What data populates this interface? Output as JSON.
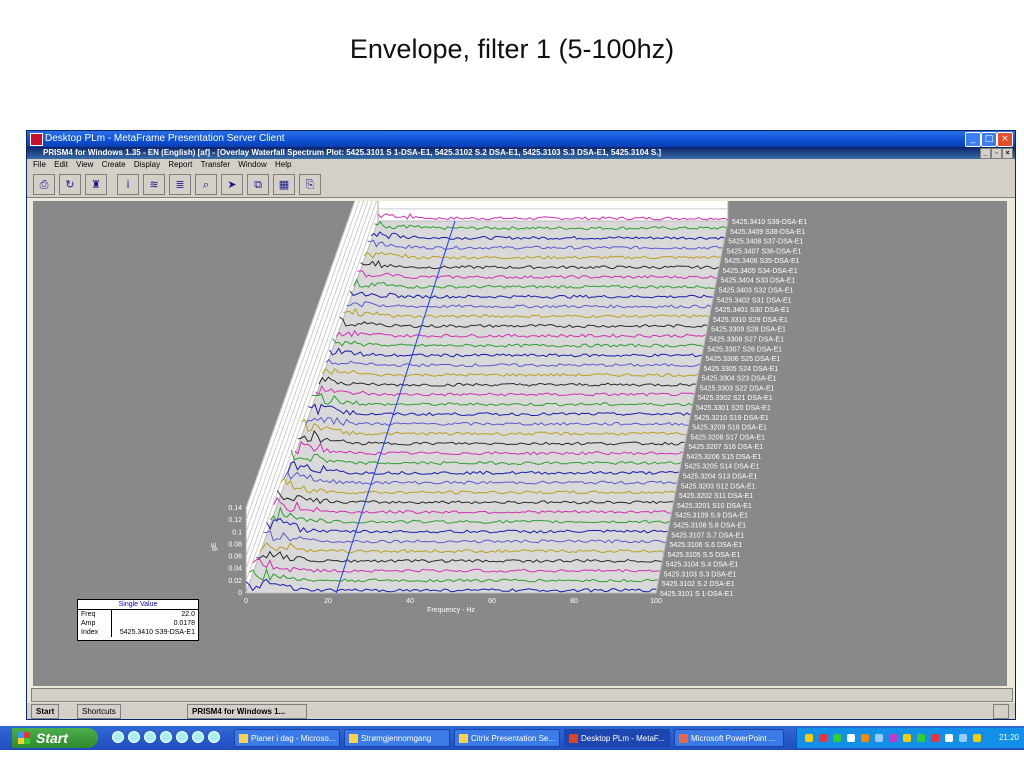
{
  "slide": {
    "title": "Envelope, filter 1 (5-100hz)"
  },
  "outer_window": {
    "title": "Desktop PLm - MetaFrame Presentation Server Client"
  },
  "inner_window": {
    "title": "PRISM4 for Windows 1.35 - EN (English) [af] - [Overlay Waterfall Spectrum Plot: 5425.3101 S 1-DSA-E1, 5425.3102 S.2 DSA-E1, 5425.3103 S.3 DSA-E1, 5425.3104 S.]"
  },
  "menu": [
    "File",
    "Edit",
    "View",
    "Create",
    "Display",
    "Report",
    "Transfer",
    "Window",
    "Help"
  ],
  "toolbar_icons": [
    "printer-icon",
    "refresh-icon",
    "tree-icon",
    "info-icon",
    "waterfall-icon",
    "spectrum-icon",
    "zoom-icon",
    "cursor-icon",
    "overlay-icon",
    "table-icon",
    "print-icon"
  ],
  "value_box": {
    "title": "Single Value",
    "rows": [
      {
        "key": "Freq",
        "value": "22.0"
      },
      {
        "key": "Amp",
        "value": "0.0178"
      },
      {
        "key": "Index",
        "value": "5425.3410 S39-DSA-E1"
      }
    ]
  },
  "chart_data": {
    "type": "line",
    "subtype": "waterfall",
    "xlabel": "Frequency - Hz",
    "ylabel": "gE",
    "xlim": [
      0,
      100
    ],
    "ylim": [
      0,
      0.14
    ],
    "x_ticks": [
      "0",
      "20",
      "40",
      "60",
      "80",
      "100"
    ],
    "y_ticks": [
      "0",
      "0.02",
      "0.04",
      "0.06",
      "0.08",
      "0.1",
      "0.12",
      "0.14"
    ],
    "cursor_freq": 22.0,
    "series_colors": [
      "#1a1ab0",
      "#2ca02c",
      "#d02fb0",
      "#2a2a2a",
      "#b8a020",
      "#5a5ad0"
    ],
    "series": [
      "5425.3101 S 1-DSA-E1",
      "5425.3102 S.2 DSA-E1",
      "5425.3103 S.3 DSA-E1",
      "5425.3104 S.4 DSA-E1",
      "5425.3105 S.5 DSA-E1",
      "5425.3106 S.6 DSA-E1",
      "5425.3107 S.7 DSA-E1",
      "5425.3108 S.8 DSA-E1",
      "5425.3109 S.9 DSA-E1",
      "5425.3201 S10 DSA-E1",
      "5425.3202 S11 DSA-E1",
      "5425.3203 S12 DSA-E1",
      "5425.3204 S13 DSA-E1",
      "5425.3205 S14 DSA-E1",
      "5425.3206 S15 DSA-E1",
      "5425.3207 S16 DSA-E1",
      "5425.3208 S17 DSA-E1",
      "5425.3209 S18 DSA-E1",
      "5425.3210 S19 DSA-E1",
      "5425.3301 S20 DSA-E1",
      "5425.3302 S21 DSA-E1",
      "5425.3303 S22 DSA-E1",
      "5425.3304 S23 DSA-E1",
      "5425.3305 S24 DSA-E1",
      "5425.3306 S25 DSA-E1",
      "5425.3307 S26 DSA-E1",
      "5425.3308 S27 DSA-E1",
      "5425.3309 S28 DSA-E1",
      "5425.3310 S29 DSA-E1",
      "5425.3401 S30 DSA-E1",
      "5425.3402 S31 DSA-E1",
      "5425.3403 S32 DSA-E1",
      "5425.3404 S33 DSA-E1",
      "5425.3405 S34-DSA-E1",
      "5425.3406 S35-DSA-E1",
      "5425.3407 S36-DSA-E1",
      "5425.3408 S37-DSA-E1",
      "5425.3409 S38-DSA-E1",
      "5425.3410 S39-DSA-E1"
    ]
  },
  "citrix_bar": {
    "start": "Start",
    "shortcuts": "Shortcuts",
    "app": "PRISM4 for Windows 1..."
  },
  "taskbar": {
    "start": "Start",
    "tasks": [
      "Planer i dag - Microso...",
      "Strømgjennomgang",
      "Citrix Presentation Se...",
      "Desktop PLm - MetaF...",
      "Microsoft PowerPoint ..."
    ],
    "clock": "21:20"
  },
  "colors": {
    "plot_bg": "#898989",
    "xp_blue": "#2458d8",
    "cursor_line": "#1a3cff"
  }
}
